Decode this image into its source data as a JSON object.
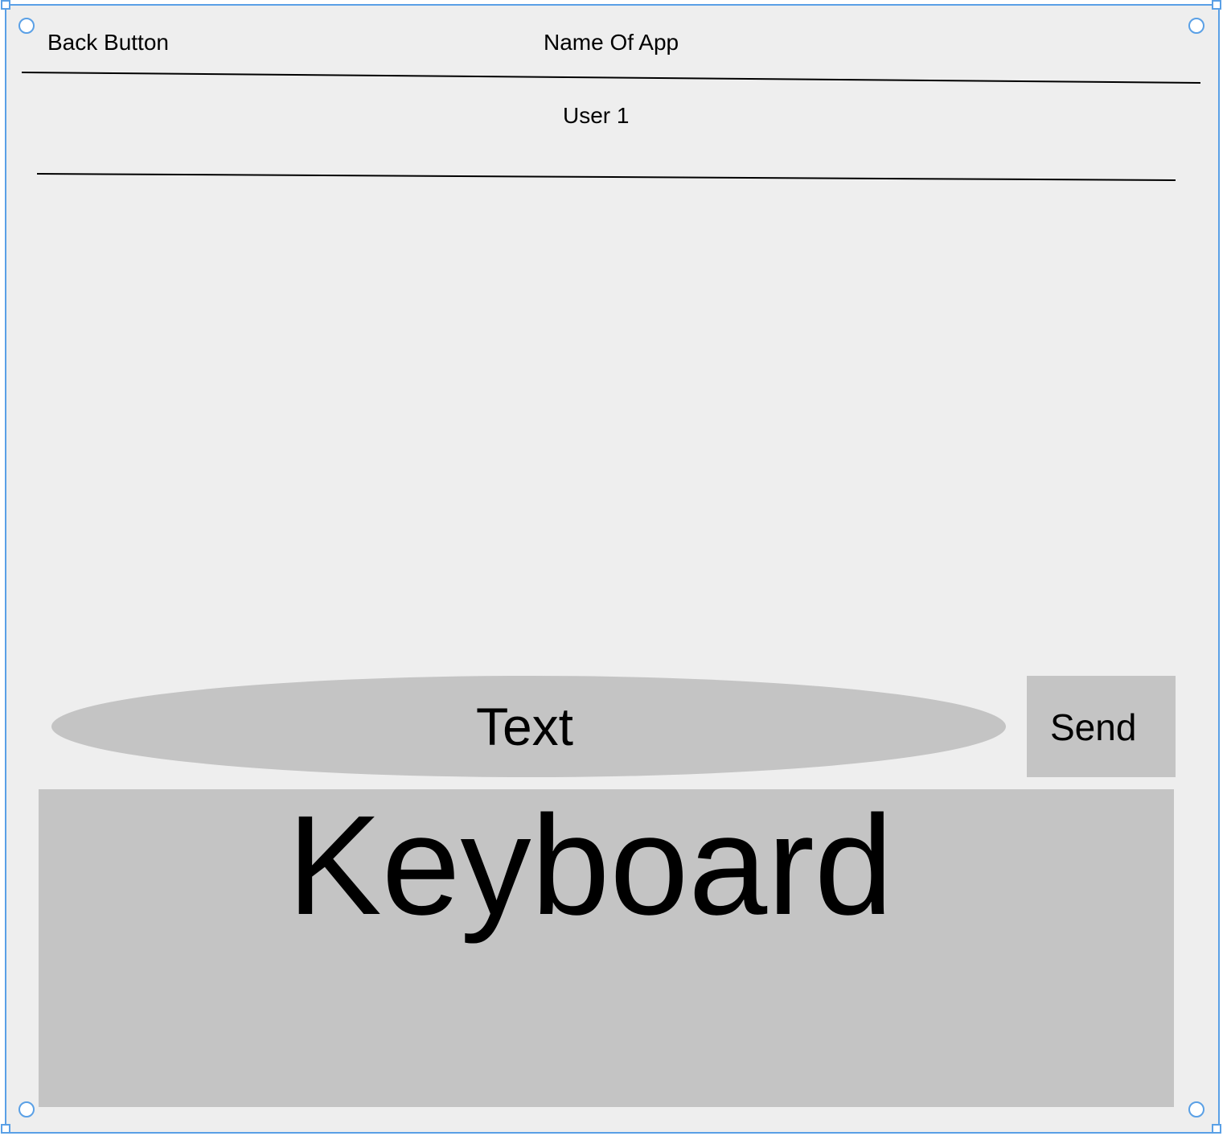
{
  "header": {
    "back_label": "Back Button",
    "app_name": "Name Of App"
  },
  "conversation": {
    "user_name": "User 1"
  },
  "composer": {
    "input_value": "Text",
    "send_label": "Send"
  },
  "keyboard": {
    "label": "Keyboard"
  },
  "colors": {
    "background": "#eeeeee",
    "placeholder_fill": "#c4c4c4",
    "selection": "#5aa0e6"
  }
}
